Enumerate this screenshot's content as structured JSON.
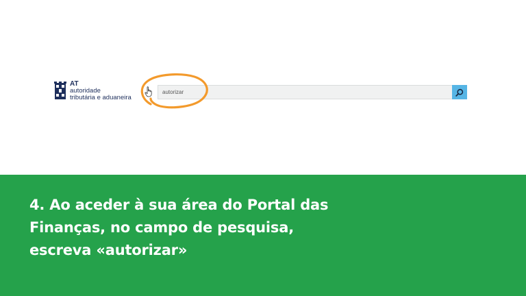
{
  "logo": {
    "acronym": "AT",
    "line1": "autoridade",
    "line2": "tributária e aduaneira",
    "color": "#1e2f5c"
  },
  "search": {
    "value": "autorizar",
    "button_icon": "search-icon",
    "button_color": "#56b5e5"
  },
  "highlight": {
    "color": "#f39a2c"
  },
  "caption": {
    "line1": "4. Ao aceder à sua área do Portal das",
    "line2": "Finanças, no campo de pesquisa,",
    "line3": "escreva «autorizar»"
  },
  "colors": {
    "panel": "#25a24b",
    "caption_text": "#ffffff"
  }
}
